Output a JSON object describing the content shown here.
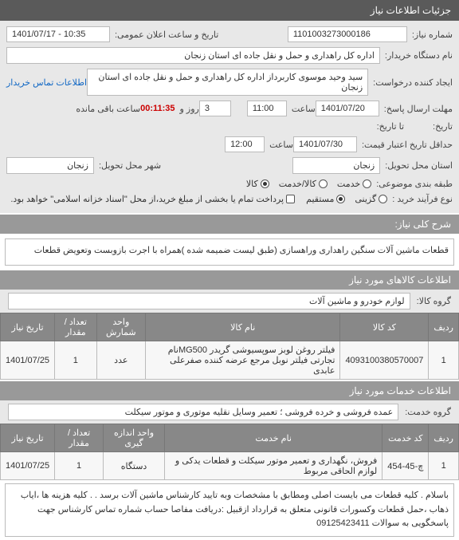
{
  "page": {
    "title": "جزئیات اطلاعات نیاز"
  },
  "form": {
    "need_number": {
      "label": "شماره نیاز:",
      "value": "1101003273000186"
    },
    "announce_dt": {
      "label": "تاریخ و ساعت اعلان عمومی:",
      "value": "1401/07/17 - 10:35"
    },
    "buyer_org": {
      "label": "نام دستگاه خریدار:",
      "value": "اداره کل راهداری و حمل و نقل جاده ای استان زنجان"
    },
    "requester": {
      "label": "ایجاد کننده درخواست:",
      "value": "سید وحید موسوی کاربرداز اداره کل راهداری و حمل و نقل جاده ای استان زنجان",
      "link": "اطلاعات تماس خریدار"
    },
    "reply_deadline": {
      "label": "مهلت ارسال پاسخ:",
      "date": "1401/07/20",
      "time_label": "ساعت",
      "time": "11:00",
      "days": "3",
      "days_label": "روز و",
      "countdown": "00:11:35",
      "remain_label": "ساعت باقی مانده"
    },
    "from_to": {
      "label": "تاریخ:",
      "label2": "تا تاریخ:"
    },
    "validity": {
      "label": "حداقل تاریخ اعتبار قیمت:",
      "date": "1401/07/30",
      "time_label": "ساعت",
      "time": "12:00"
    },
    "province": {
      "label": "استان محل تحویل:",
      "value": "زنجان"
    },
    "city": {
      "label": "شهر محل تحویل:",
      "value": "زنجان"
    },
    "topic": {
      "label": "طبقه بندی موضوعی:",
      "options": [
        {
          "name": "خدمت",
          "selected": false
        },
        {
          "name": "کالا/خدمت",
          "selected": false
        },
        {
          "name": "کالا",
          "selected": true
        }
      ]
    },
    "buy_process": {
      "label": "نوع فرآیند خرید :",
      "options": [
        {
          "name": "گزینی",
          "selected": false
        },
        {
          "name": "مستقیم",
          "selected": true
        }
      ],
      "note": "پرداخت تمام یا بخشی از مبلغ خرید،از محل \"اسناد خزانه اسلامی\" خواهد بود.",
      "checkbox_empty": true
    }
  },
  "need_desc": {
    "header": "شرح کلی نیاز:",
    "text": "قطعات ماشین آلات سنگین راهداری وراهسازی (طبق لیست ضمیمه شده )همراه با اجرت بازوبست وتعویض قطعات"
  },
  "goods": {
    "header": "اطلاعات کالاهای مورد نیاز",
    "group_label": "گروه کالا:",
    "group_value": "لوازم خودرو و ماشین آلات",
    "cols": [
      "ردیف",
      "کد کالا",
      "نام کالا",
      "واحد شمارش",
      "تعداد / مقدار",
      "تاریخ نیاز"
    ],
    "rows": [
      {
        "idx": "1",
        "code": "4093100380570007",
        "name": "فیلتر روغن لوبز سوپسیوشی گریدر MG500نام تجارتی فیلتر نوبل مرجع عرضه کننده صفرعلی عابدی",
        "unit": "عدد",
        "qty": "1",
        "date": "1401/07/25"
      }
    ]
  },
  "services": {
    "header": "اطلاعات خدمات مورد نیاز",
    "group_label": "گروه خدمت:",
    "group_value": "عمده فروشی و خرده فروشی ؛ تعمیر وسایل نقلیه موتوری و موتور سیکلت",
    "cols": [
      "ردیف",
      "کد خدمت",
      "نام خدمت",
      "واحد اندازه گیری",
      "تعداد / مقدار",
      "تاریخ نیاز"
    ],
    "rows": [
      {
        "idx": "1",
        "code": "چ-45-454",
        "name": "فروش، نگهداری و تعمیر موتور سیکلت و قطعات یدکی و لوازم الحاقی مربوط",
        "unit": "دستگاه",
        "qty": "1",
        "date": "1401/07/25"
      }
    ]
  },
  "footnote": "باسلام . کلیه قطعات می بایست اصلی ومطابق با مشخصات وبه تایید کارشناس ماشین آلات برسد . . کلیه هزینه ها ،ایاب ذهاب ،حمل قطعات وکسورات قانونی متعلق به قرارداد ازقبیل :دریافت مفاصا حساب شماره تماس کارشناس جهت پاسخگویی به سوالات 09125423411"
}
